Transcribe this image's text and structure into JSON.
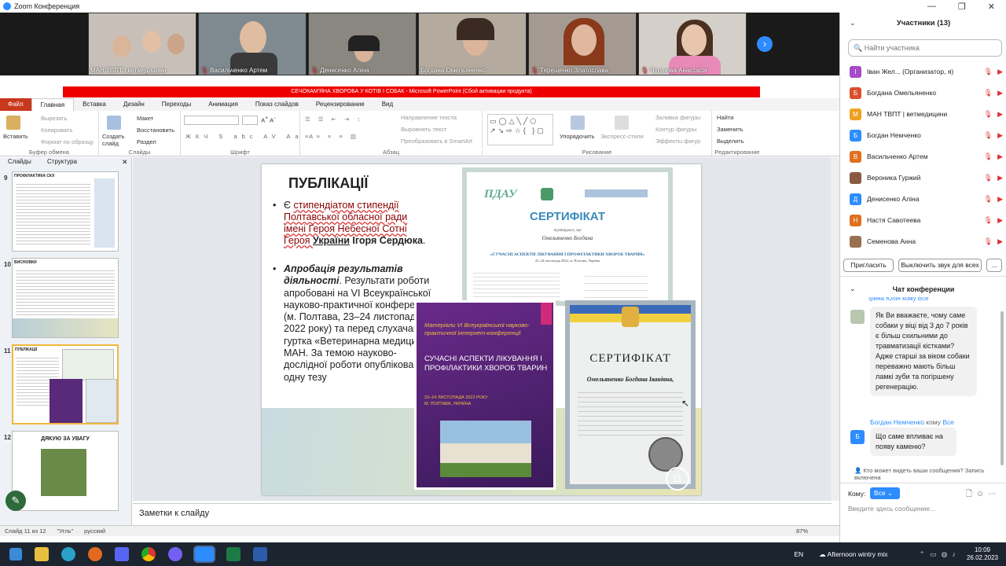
{
  "window": {
    "title": "Zoom Конференция"
  },
  "video_tiles": [
    {
      "name": "МАН ТВПТ | ветмедицини"
    },
    {
      "name": "Васильченко Артем"
    },
    {
      "name": "Денисенко Аліна"
    },
    {
      "name": "Богдана Омельяненко"
    },
    {
      "name": "Терещенко Златослава"
    },
    {
      "name": "Чугунова Анастасія"
    }
  ],
  "ppt": {
    "title_bar": "СЕЧОКАМ'ЯНА ХВОРОБА У КОТІВ І СОБАК - Microsoft PowerPoint (Сбой активации продукта)",
    "tabs": [
      "Файл",
      "Главная",
      "Вставка",
      "Дизайн",
      "Переходы",
      "Анимация",
      "Показ слайдов",
      "Рецензирование",
      "Вид"
    ],
    "ribbon": {
      "clipboard": {
        "paste": "Вставить",
        "cut": "Вырезать",
        "copy": "Копировать",
        "format": "Формат по образцу",
        "label": "Буфер обмена"
      },
      "slides": {
        "new": "Создать слайд",
        "layout": "Макет",
        "reset": "Восстановить",
        "section": "Раздел",
        "label": "Слайды"
      },
      "font": {
        "label": "Шрифт"
      },
      "paragraph": {
        "direction": "Направление текста",
        "align": "Выровнять текст",
        "smartart": "Преобразовать в SmartArt",
        "label": "Абзац"
      },
      "drawing": {
        "arrange": "Упорядочить",
        "styles": "Экспресс-стили",
        "fill": "Заливка фигуры",
        "outline": "Контур фигуры",
        "effects": "Эффекты фигур",
        "label": "Рисование"
      },
      "editing": {
        "find": "Найти",
        "replace": "Заменить",
        "select": "Выделить",
        "label": "Редактирование"
      }
    },
    "pane_tabs": [
      "Слайды",
      "Структура"
    ],
    "thumbs": [
      {
        "num": "9",
        "title": "ПРОФІЛАКТИКА СКХ"
      },
      {
        "num": "10",
        "title": "ВИСНОВКИ"
      },
      {
        "num": "11",
        "title": "ПУБЛІКАЦІЇ"
      },
      {
        "num": "12",
        "title": "ДЯКУЮ ЗА УВАГУ"
      }
    ],
    "slide": {
      "heading": "ПУБЛІКАЦІЇ",
      "bullet1_parts": [
        "Є ",
        "стипендіатом стипендії Полтавської обласної ради імені Героя Небесної Сотні Героя ",
        "України",
        " Ігоря Сердюка",
        "."
      ],
      "bullet2_title": "Апробація результатів діяльності",
      "bullet2_body": ". Результати роботи апробовані на VI Всеукраїнської науково-практичної конференції (м. Полтава, 23–24 листопада 2022 року) та  перед слухачами гуртка «Ветеринарна медицина» МАН. За темою науково-дослідної роботи опубліковано одну тезу",
      "cert1": {
        "logo": "ПДАУ",
        "heading": "СЕРТИФІКАТ",
        "confirms": "підтверджує, що",
        "name": "Омельяненко Богдана",
        "conf": "«СУЧАСНІ АСПЕКТИ ЛІКУВАННЯ І ПРОФІЛАКТИКИ ХВОРОБ ТВАРИН»",
        "date": "23–24 листопада 2022, м. Полтава, Україна"
      },
      "book": {
        "intro": "Матеріали VI Всеукраїнської науково-практичної інтернет-конференції",
        "title": "СУЧАСНІ АСПЕКТИ ЛІКУВАННЯ І ПРОФІЛАКТИКИ ХВОРОБ ТВАРИН",
        "date": "23–24 ЛИСТОПАДА 2022 РОКУ",
        "city": "М. ПОЛТАВА, УКРАЇНА"
      },
      "cert2": {
        "heading": "СЕРТИФІКАТ",
        "name": "Омельяненко Богдана Іванівна,",
        "number": "11"
      }
    },
    "notes": "Заметки к слайду",
    "status": {
      "slide": "Слайд 11 из 12",
      "theme": "\"Угль\"",
      "lang": "русский",
      "zoom": "87%"
    }
  },
  "participants": {
    "title": "Участники (13)",
    "search_placeholder": "Найти участника",
    "list": [
      {
        "initial": "І",
        "name": "Іван Жел... (Организатор, я)",
        "color": "#a64ac9"
      },
      {
        "initial": "Б",
        "name": "Богдана Омельяненко",
        "color": "#d9502e"
      },
      {
        "initial": "М",
        "name": "МАН ТВПТ | ветмедицини",
        "color": "#f0a020"
      },
      {
        "initial": "Б",
        "name": "Богдан Немченко",
        "color": "#2d8cff"
      },
      {
        "initial": "В",
        "name": "Васильченко Артем",
        "color": "#e0701e"
      },
      {
        "initial": "",
        "name": "Вероника Гуржий",
        "color": "#8a5a40"
      },
      {
        "initial": "Д",
        "name": "Денисенко Аліна",
        "color": "#2d8cff"
      },
      {
        "initial": "Н",
        "name": "Настя Савотеева",
        "color": "#e0701e"
      },
      {
        "initial": "",
        "name": "Семенова Анна",
        "color": "#9a7050"
      }
    ],
    "invite": "Пригласить",
    "mute_all": "Выключить звук для всех",
    "more": "..."
  },
  "chat": {
    "title": "Чат конференции",
    "partial_sender": "Ірина Юлія кому Все",
    "msg1": "Як Ви вважаєте, чому саме собаки у віці від 3 до 7 років є більш схильними до травматизації кістками? Адже старші за віком собаки переважно мають більш ламкі зуби та погіршену регенерацію.",
    "sender2": "Богдан Немченко",
    "to_word": "кому",
    "to2": "Все",
    "msg2": "Що саме впливає на появу каменю?",
    "privacy": "Кто может видеть ваши сообщения? Запись включена",
    "to_label": "Кому:",
    "to_value": "Все",
    "input_placeholder": "Введите здесь сообщение..."
  },
  "taskbar": {
    "weather": "Afternoon wintry mix",
    "lang": "EN",
    "time": "10:09",
    "date": "26.02.2023"
  }
}
